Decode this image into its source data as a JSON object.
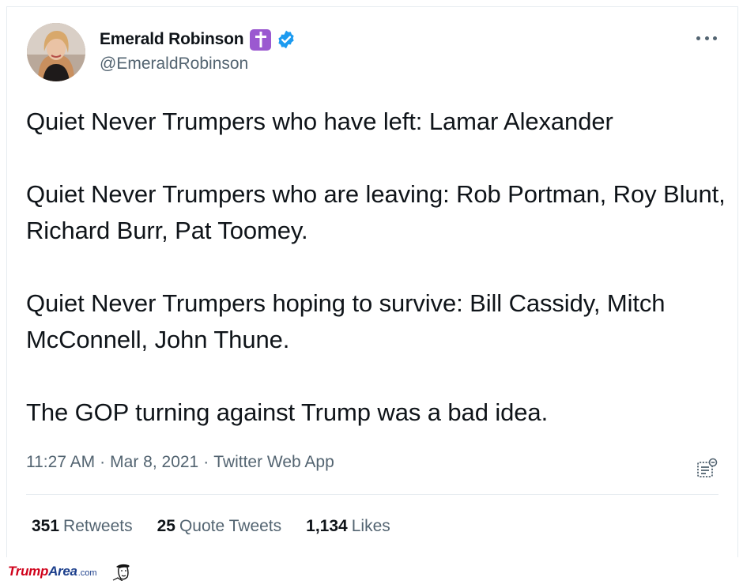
{
  "tweet": {
    "display_name": "Emerald Robinson",
    "handle": "@EmeraldRobinson",
    "paragraphs": [
      "Quiet Never Trumpers who have left: Lamar Alexander",
      "Quiet Never Trumpers who are leaving: Rob Portman, Roy Blunt, Richard Burr, Pat Toomey.",
      "Quiet Never Trumpers hoping to survive: Bill Cassidy, Mitch McConnell, John Thune.",
      "The GOP turning against Trump was a bad idea."
    ],
    "time": "11:27 AM",
    "date": "Mar 8, 2021",
    "source": "Twitter Web App",
    "separator": "·"
  },
  "stats": {
    "retweets": {
      "count": "351",
      "label": "Retweets"
    },
    "quotes": {
      "count": "25",
      "label": "Quote Tweets"
    },
    "likes": {
      "count": "1,134",
      "label": "Likes"
    }
  },
  "icons": {
    "name_badge": "latin-cross-icon",
    "verified": "verified-badge-icon",
    "more": "more-options-icon",
    "analytics": "tweet-analytics-icon"
  },
  "colors": {
    "verified_blue": "#1d9bf0",
    "cross_badge": "#9b59d0",
    "secondary_text": "#536471",
    "watermark_red": "#d0021b",
    "watermark_blue": "#1c3f8c"
  },
  "watermark": {
    "part1": "Trump",
    "part2": "Area",
    "part3": ".com"
  }
}
